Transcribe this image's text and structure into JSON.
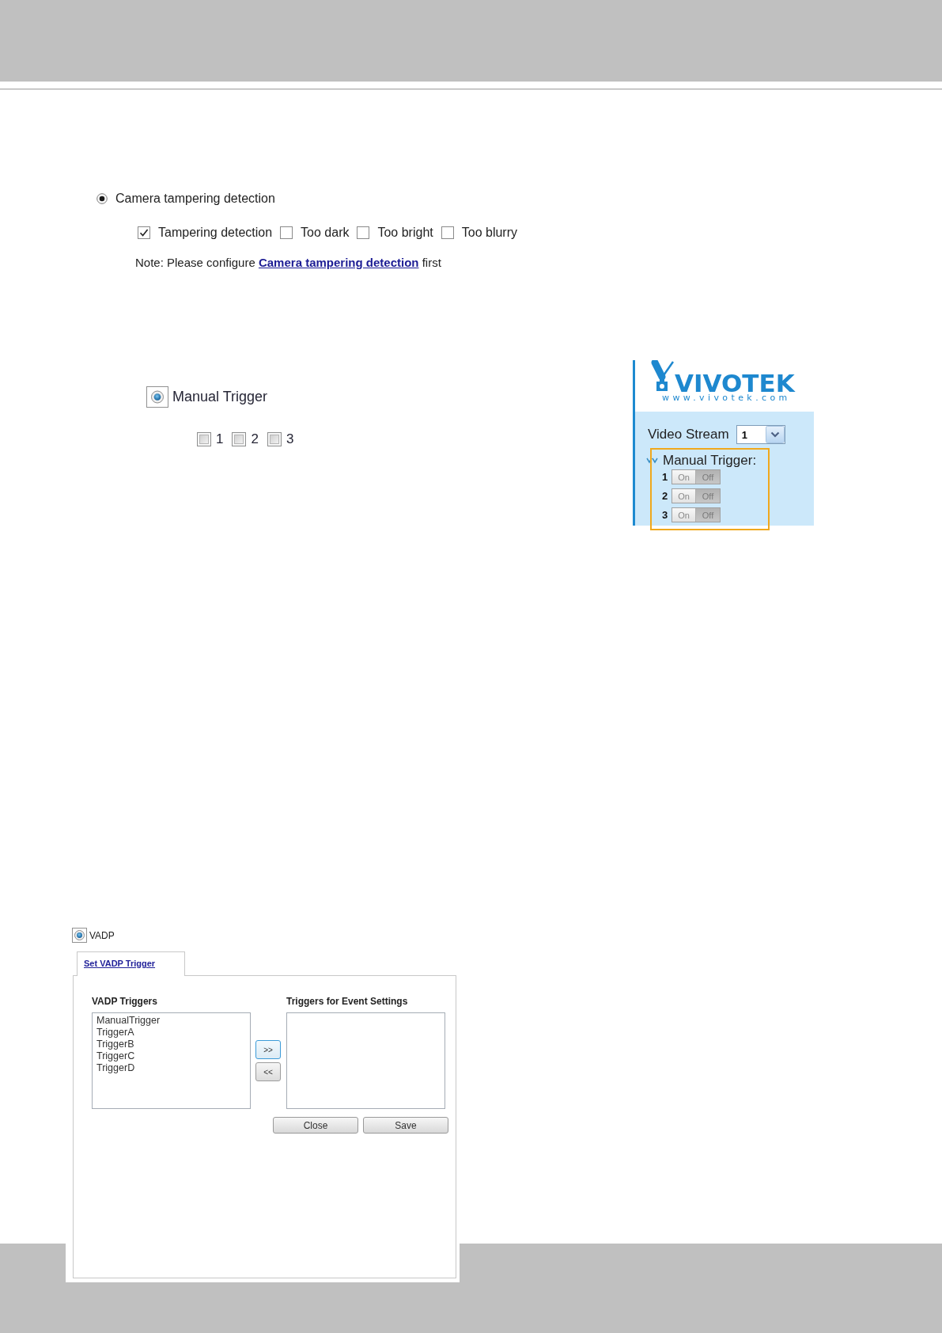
{
  "camera_tampering": {
    "label": "Camera tampering detection",
    "selected": true,
    "options": [
      {
        "label": "Tampering detection",
        "checked": true
      },
      {
        "label": "Too dark",
        "checked": false
      },
      {
        "label": "Too bright",
        "checked": false
      },
      {
        "label": "Too blurry",
        "checked": false
      }
    ],
    "note": {
      "text": "Note: Please configure",
      "link": "Camera tampering detection",
      "suffix": "first"
    }
  },
  "manual_trigger": {
    "label": "Manual Trigger",
    "selected": true,
    "focused": true,
    "options": [
      {
        "label": "1",
        "checked": false
      },
      {
        "label": "2",
        "checked": false
      },
      {
        "label": "3",
        "checked": false
      }
    ]
  },
  "web_panel": {
    "logo": {
      "name": "VIVOTEK",
      "url": "www.vivotek.com"
    },
    "video_stream": {
      "label": "Video Stream",
      "value": "1"
    },
    "manual_trigger": {
      "label": "Manual Trigger:",
      "triggers": [
        {
          "number": "1",
          "on_label": "On",
          "off_label": "Off",
          "on": false
        },
        {
          "number": "2",
          "on_label": "On",
          "off_label": "Off",
          "on": false
        },
        {
          "number": "3",
          "on_label": "On",
          "off_label": "Off",
          "on": false
        }
      ]
    }
  },
  "vadp": {
    "label": "VADP",
    "selected": true,
    "focused": true,
    "tab": {
      "label": "Set VADP Trigger",
      "selected": true
    },
    "available": {
      "heading": "VADP Triggers",
      "items": [
        "ManualTrigger",
        "TriggerA",
        "TriggerB",
        "TriggerC",
        "TriggerD"
      ]
    },
    "move_buttons": [
      {
        "label": ">>",
        "focused": true
      },
      {
        "label": "<<",
        "focused": false
      }
    ],
    "chosen": {
      "heading": "Triggers for Event Settings"
    },
    "buttons": [
      "Close",
      "Save"
    ]
  }
}
